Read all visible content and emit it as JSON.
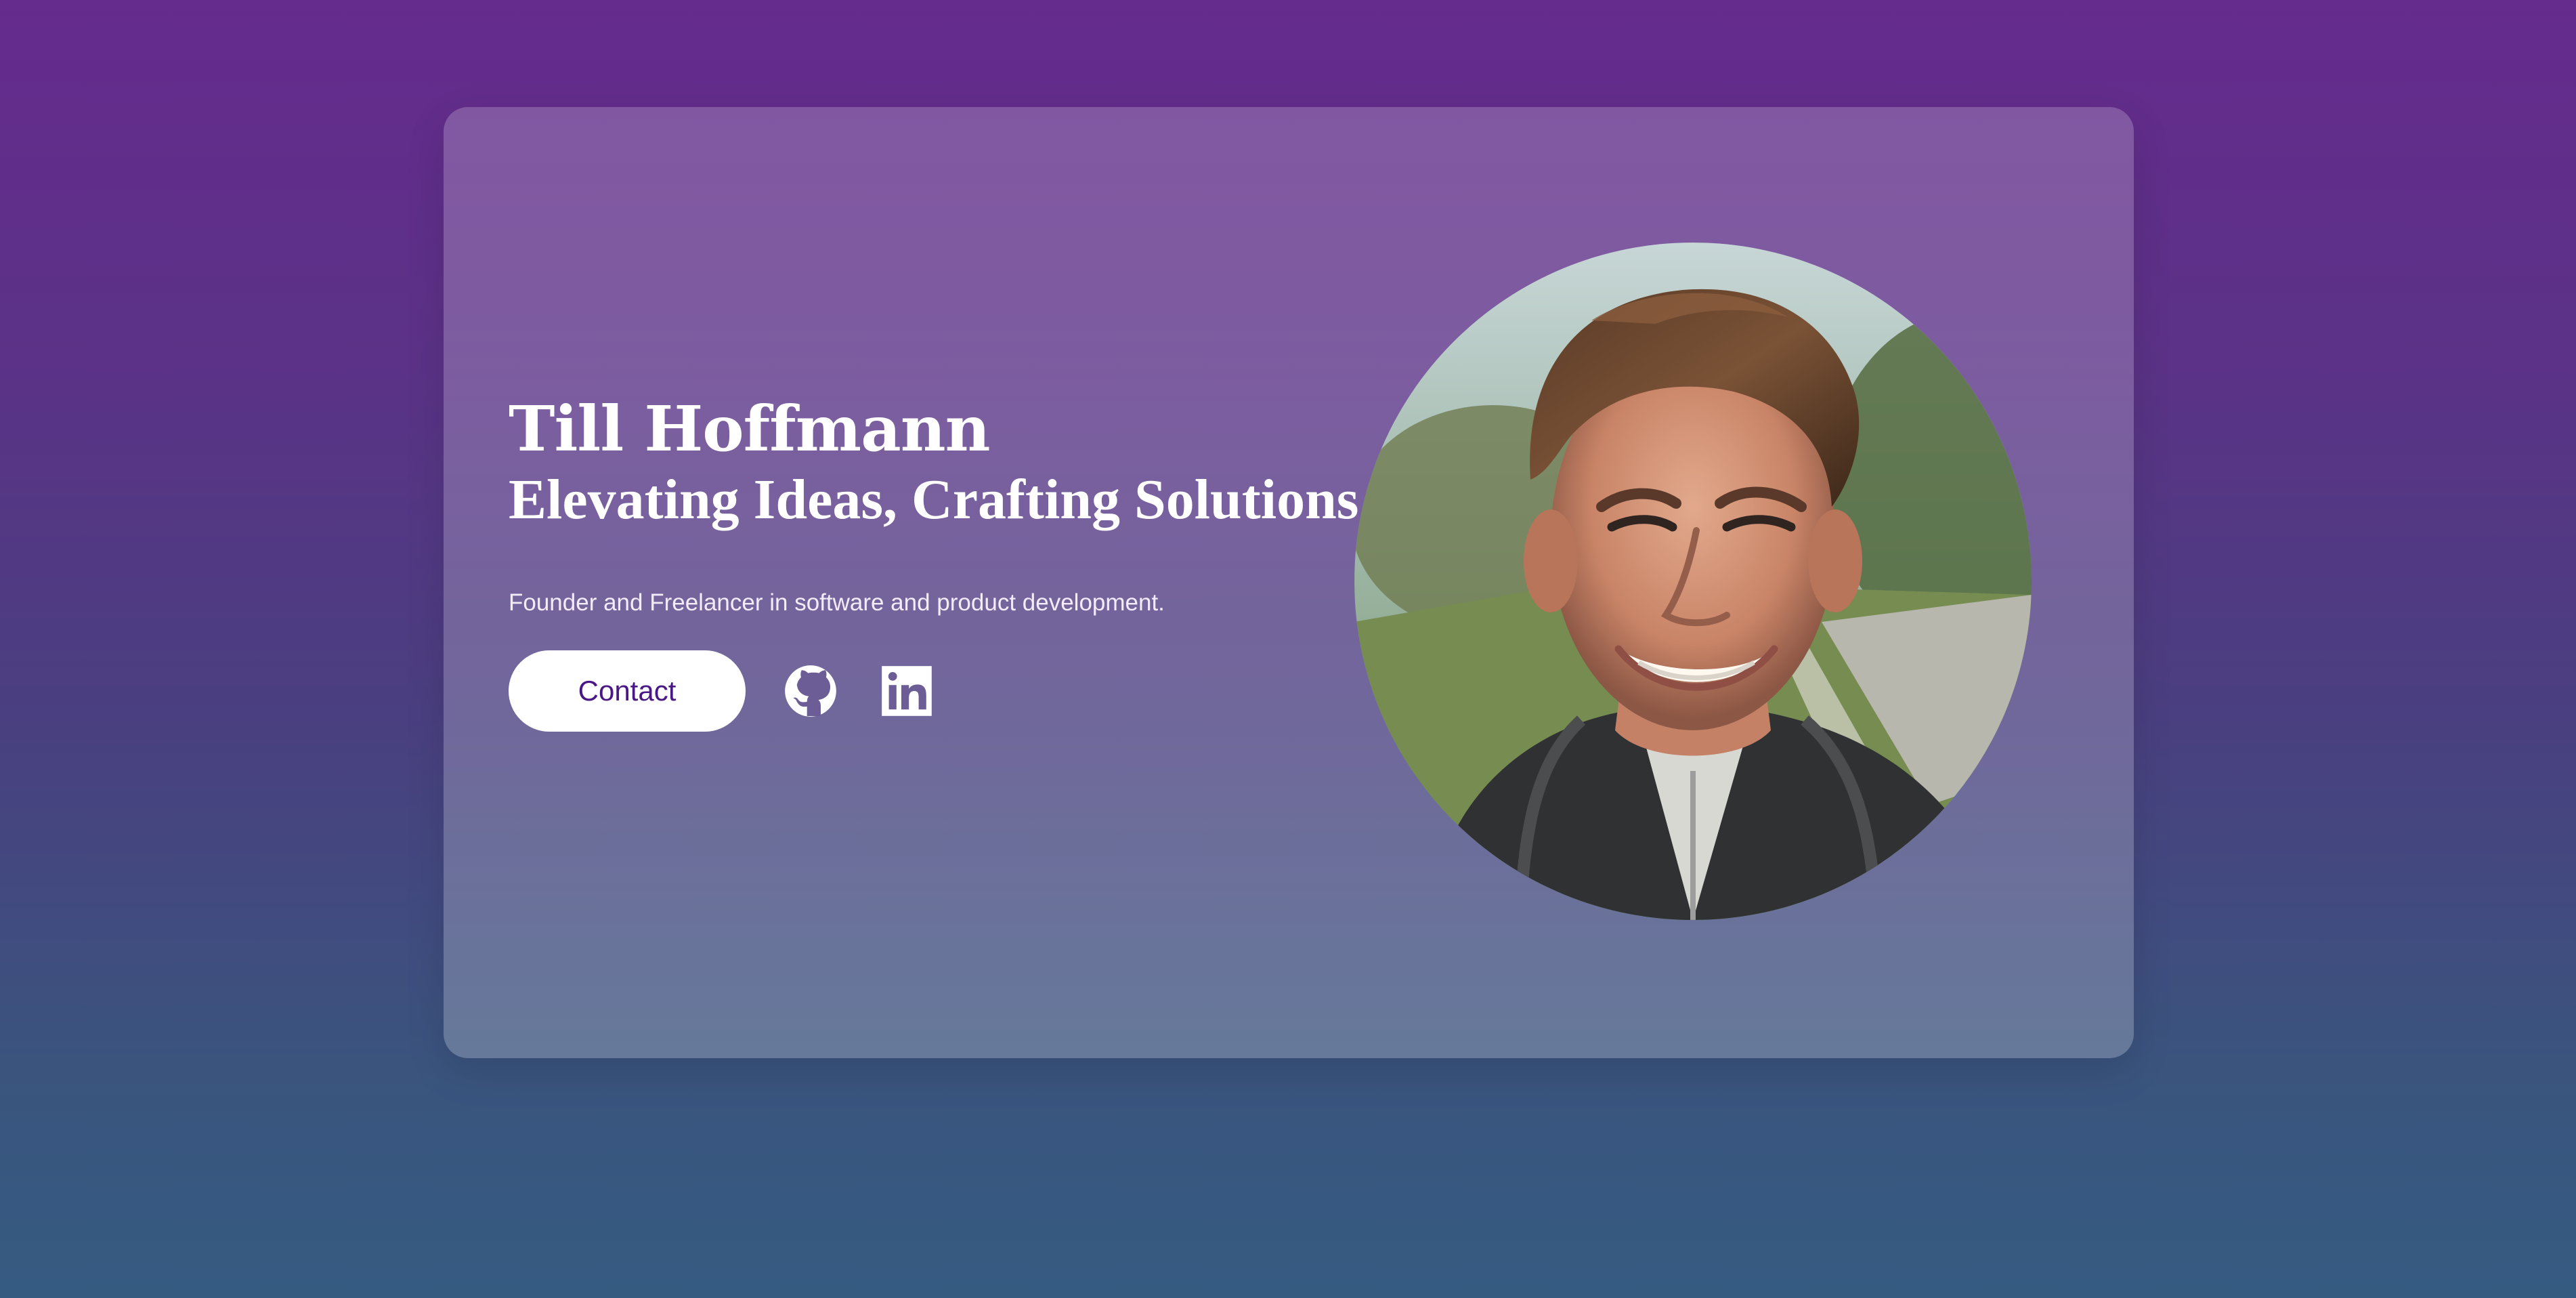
{
  "profile": {
    "name": "Till Hoffmann",
    "tagline": "Elevating Ideas, Crafting Solutions",
    "description": "Founder and Freelancer in software and product development."
  },
  "actions": {
    "contact_label": "Contact",
    "github_icon": "github-icon",
    "linkedin_icon": "linkedin-icon"
  },
  "portrait": {
    "alt": "Till Hoffmann"
  },
  "colors": {
    "background_top": "#652b8d",
    "background_bottom": "#355b81",
    "button_text": "#4a1787",
    "text": "#ffffff"
  }
}
